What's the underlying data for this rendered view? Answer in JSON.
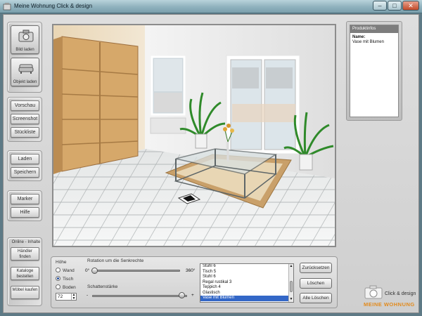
{
  "window": {
    "title": "Meine Wohnung Click & design"
  },
  "left_toolbar": {
    "load_image": "Bild laden",
    "load_object": "Objekt laden",
    "preview": "Vorschau",
    "screenshot": "Screenshot",
    "parts_list": "Stückliste",
    "load": "Laden",
    "save": "Speichern",
    "marker": "Marker",
    "help": "Hilfe",
    "online_title": "Online - Inhalte",
    "find_dealer": "Händler finden",
    "order_catalogue": "Kataloge bestellen",
    "buy_furniture": "Möbel kaufen"
  },
  "product_info": {
    "header": "Produktinfos",
    "name_label": "Name:",
    "name_value": "Vase mit Blumen"
  },
  "bottom_panel": {
    "height_title": "Höhe",
    "height_options": [
      "Wand",
      "Tisch",
      "Boden"
    ],
    "height_selected": "Tisch",
    "height_value": "72",
    "rotation_title": "Rotation um die Senkrechte",
    "rotation_min": "0°",
    "rotation_max": "360°",
    "rotation_value": 0,
    "shadow_title": "Schattenstärke",
    "shadow_min": "-",
    "shadow_max": "+",
    "shadow_value": 0.95,
    "object_list": [
      "Stuhl 6",
      "Tisch 5",
      "Stuhl 6",
      "Regal rustikal 3",
      "Teppich 4",
      "Glastisch",
      "Vase mit Blumen"
    ],
    "object_selected": "Vase mit Blumen",
    "reset_button": "Zurücksetzen",
    "delete_button": "Löschen",
    "delete_all_button": "Alle Löschen"
  },
  "branding": {
    "text": "Click & design",
    "brand": "MEINE WOHNUNG"
  },
  "colors": {
    "accent": "#3367c7",
    "brand": "#e28a1c",
    "titlebar": "#8fb1bd"
  },
  "icons": [
    "app-icon",
    "minimize-icon",
    "maximize-icon",
    "close-icon",
    "camera-icon",
    "sofa-icon",
    "spinner-icon",
    "scrollbar-arrow-icon"
  ]
}
